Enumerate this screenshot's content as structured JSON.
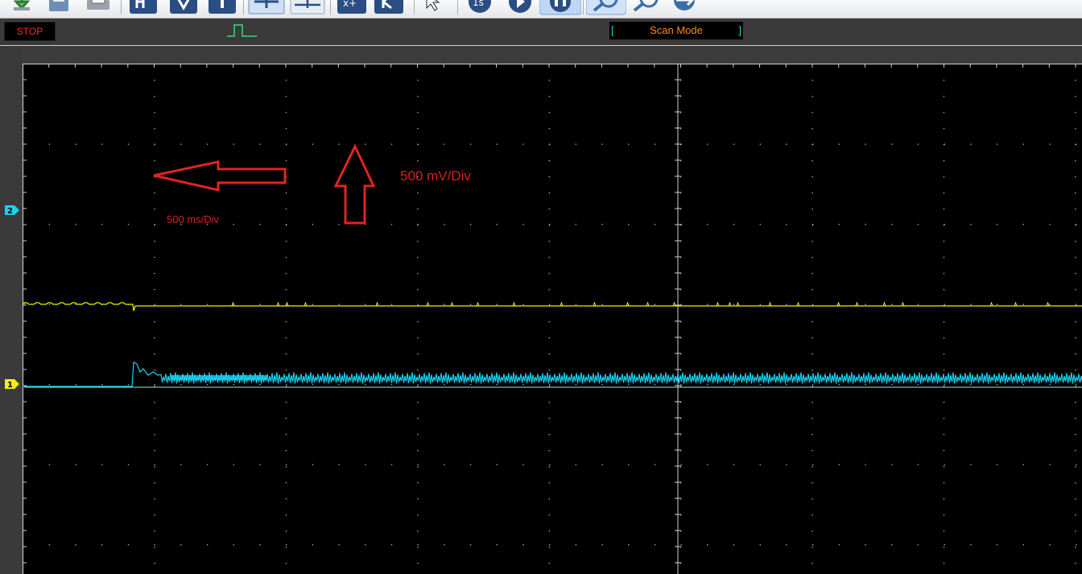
{
  "status": {
    "run_state": "STOP",
    "run_state_color": "#ff2a2a",
    "trigger_icon": "pulse-trigger-icon",
    "mode_bracket_left": "[",
    "mode_label": "Scan Mode",
    "mode_bracket_right": "]",
    "mode_color": "#ff8a1a"
  },
  "toolbar": {
    "icons": [
      "download-icon",
      "save-icon",
      "print-icon",
      "horizontal-cursor-icon",
      "vertical-cursor-icon",
      "trigger-icon",
      "split-view-icon",
      "quad-view-icon",
      "math-icon",
      "reference-icon",
      "select-icon",
      "single-shot-icon",
      "run-icon",
      "pause-icon",
      "zoom-in-icon",
      "zoom-out-icon",
      "zoom-fit-icon"
    ]
  },
  "channels": [
    {
      "id": "2",
      "color": "#19d3f0",
      "label": "2"
    },
    {
      "id": "1",
      "color": "#f3f000",
      "label": "1"
    }
  ],
  "annotations": {
    "time_scale": "500 ms/Div",
    "voltage_scale": "500 mV/Div",
    "color": "#d62020"
  },
  "colors": {
    "screen_background": "#000000",
    "grid_dots": "#a6a6a6",
    "channel1_trace": "#f3f000",
    "channel2_trace": "#19d3f0"
  }
}
